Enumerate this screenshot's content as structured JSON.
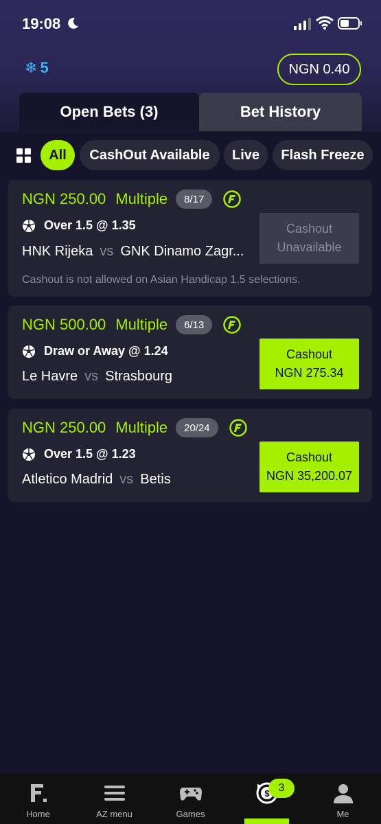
{
  "status_bar": {
    "time": "19:08"
  },
  "header": {
    "freeze_count": "5",
    "balance": "NGN 0.40"
  },
  "tabs": [
    {
      "label": "Open Bets (3)",
      "active": true
    },
    {
      "label": "Bet History",
      "active": false
    }
  ],
  "filters": [
    {
      "label": "All",
      "active": true
    },
    {
      "label": "CashOut Available",
      "active": false
    },
    {
      "label": "Live",
      "active": false
    },
    {
      "label": "Flash Freeze",
      "active": false
    }
  ],
  "bets": [
    {
      "stake": "NGN 250.00",
      "type": "Multiple",
      "legs": "8/17",
      "selection": "Over 1.5 @ 1.35",
      "home": "HNK Rijeka",
      "vs": "vs",
      "away": "GNK Dinamo Zagr...",
      "cashout_line1": "Cashout",
      "cashout_line2": "Unavailable",
      "cashout_available": false,
      "note": "Cashout is not allowed on Asian Handicap 1.5 selections."
    },
    {
      "stake": "NGN 500.00",
      "type": "Multiple",
      "legs": "6/13",
      "selection": "Draw or Away @ 1.24",
      "home": "Le Havre",
      "vs": "vs",
      "away": "Strasbourg",
      "cashout_line1": "Cashout",
      "cashout_line2": "NGN 275.34",
      "cashout_available": true
    },
    {
      "stake": "NGN 250.00",
      "type": "Multiple",
      "legs": "20/24",
      "selection": "Over 1.5 @ 1.23",
      "home": "Atletico Madrid",
      "vs": "vs",
      "away": "Betis",
      "cashout_line1": "Cashout",
      "cashout_line2": "NGN 35,200.07",
      "cashout_available": true
    }
  ],
  "bottom_nav": [
    {
      "label": "Home",
      "icon": "home-logo-icon"
    },
    {
      "label": "AZ menu",
      "icon": "menu-icon"
    },
    {
      "label": "Games",
      "icon": "gamepad-icon"
    },
    {
      "label": "",
      "icon": "cashout-coin-icon",
      "badge": "3",
      "active": true
    },
    {
      "label": "Me",
      "icon": "user-icon"
    }
  ],
  "colors": {
    "accent": "#a4f000",
    "background": "#16142a",
    "card": "#242333",
    "freeze_blue": "#39b6f0"
  }
}
